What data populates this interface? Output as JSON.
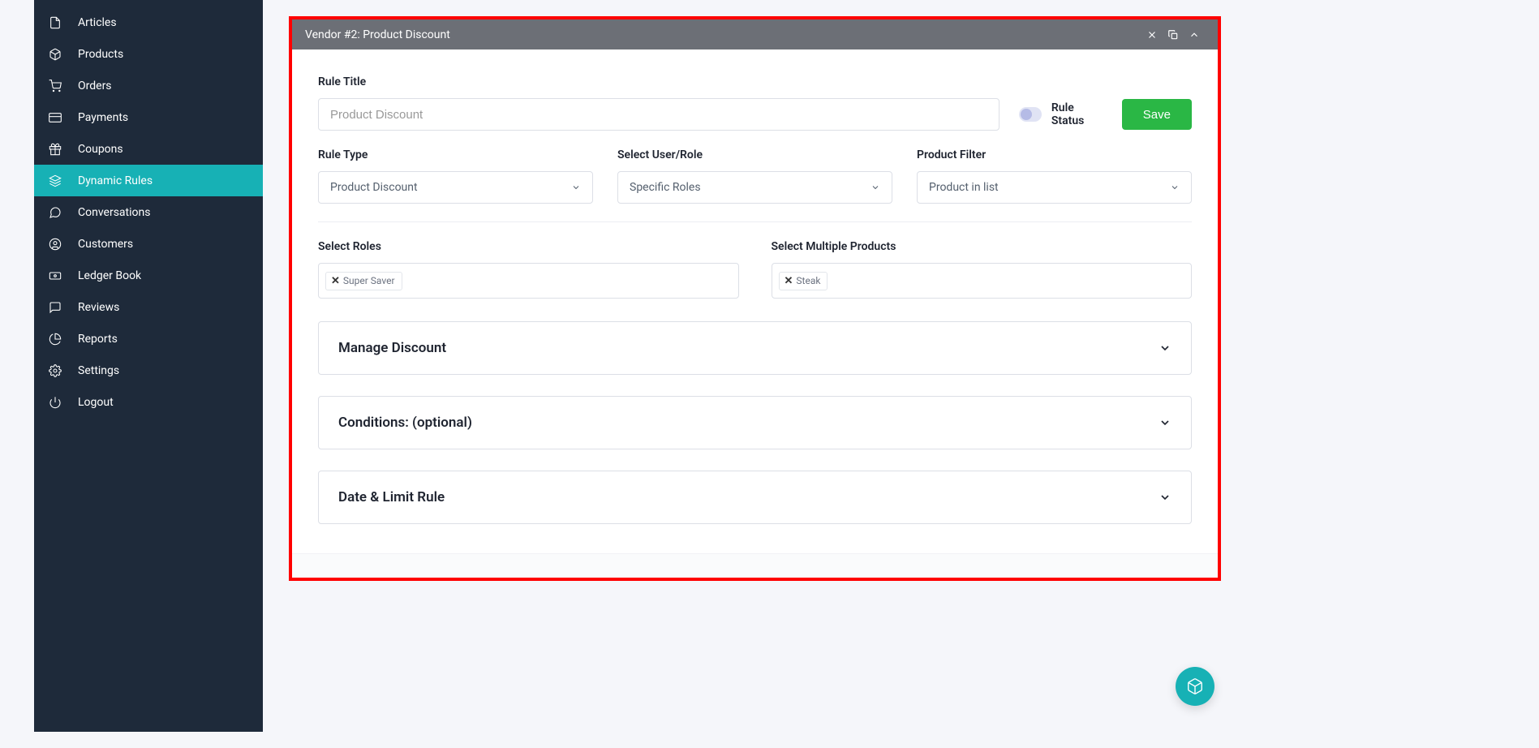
{
  "sidebar": {
    "items": [
      {
        "label": "Articles",
        "id": "articles"
      },
      {
        "label": "Products",
        "id": "products"
      },
      {
        "label": "Orders",
        "id": "orders"
      },
      {
        "label": "Payments",
        "id": "payments"
      },
      {
        "label": "Coupons",
        "id": "coupons"
      },
      {
        "label": "Dynamic Rules",
        "id": "dynamic-rules",
        "active": true
      },
      {
        "label": "Conversations",
        "id": "conversations"
      },
      {
        "label": "Customers",
        "id": "customers"
      },
      {
        "label": "Ledger Book",
        "id": "ledger-book"
      },
      {
        "label": "Reviews",
        "id": "reviews"
      },
      {
        "label": "Reports",
        "id": "reports"
      },
      {
        "label": "Settings",
        "id": "settings"
      },
      {
        "label": "Logout",
        "id": "logout"
      }
    ]
  },
  "panel": {
    "header": "Vendor #2: Product Discount"
  },
  "form": {
    "rule_title_label": "Rule Title",
    "rule_title_placeholder": "Product Discount",
    "rule_status_label": "Rule Status",
    "save_label": "Save",
    "rule_type_label": "Rule Type",
    "rule_type_value": "Product Discount",
    "select_user_role_label": "Select User/Role",
    "select_user_role_value": "Specific Roles",
    "product_filter_label": "Product Filter",
    "product_filter_value": "Product in list",
    "select_roles_label": "Select Roles",
    "roles_tag": "Super Saver",
    "select_products_label": "Select Multiple Products",
    "products_tag": "Steak"
  },
  "accordions": {
    "manage_discount": "Manage Discount",
    "conditions": "Conditions: (optional)",
    "date_limit": "Date & Limit Rule"
  }
}
